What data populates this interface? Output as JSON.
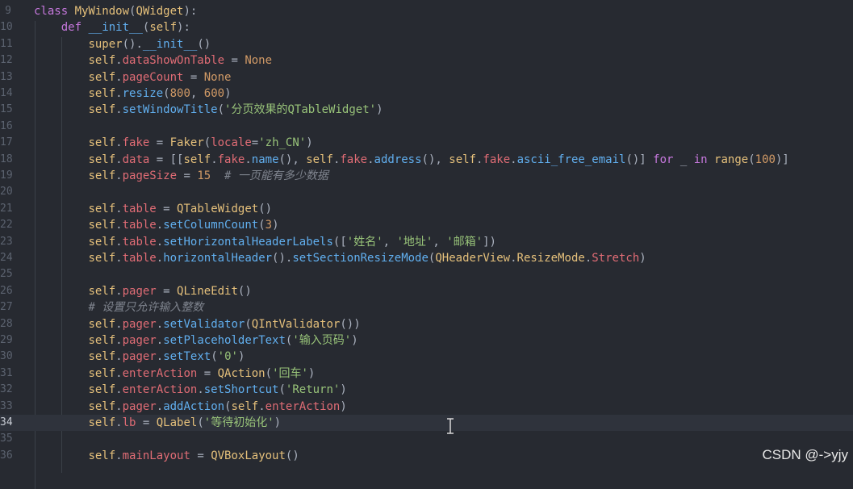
{
  "watermark": "CSDN @->yjy",
  "lines": [
    {
      "n": "9",
      "t": [
        [
          "kw",
          "class "
        ],
        [
          "cl",
          "MyWindow"
        ],
        [
          "pn",
          "("
        ],
        [
          "cl",
          "QWidget"
        ],
        [
          "pn",
          "):"
        ]
      ]
    },
    {
      "n": "10",
      "t": [
        [
          "pn",
          "    "
        ],
        [
          "kw",
          "def "
        ],
        [
          "fn",
          "__init__"
        ],
        [
          "pn",
          "("
        ],
        [
          "sf",
          "self"
        ],
        [
          "pn",
          "):"
        ]
      ]
    },
    {
      "n": "11",
      "t": [
        [
          "pn",
          "        "
        ],
        [
          "bi",
          "super"
        ],
        [
          "pn",
          "()."
        ],
        [
          "fn",
          "__init__"
        ],
        [
          "pn",
          "()"
        ]
      ]
    },
    {
      "n": "12",
      "t": [
        [
          "pn",
          "        "
        ],
        [
          "sf",
          "self"
        ],
        [
          "pn",
          "."
        ],
        [
          "at",
          "dataShowOnTable"
        ],
        [
          "pn",
          " = "
        ],
        [
          "nm",
          "None"
        ]
      ]
    },
    {
      "n": "13",
      "t": [
        [
          "pn",
          "        "
        ],
        [
          "sf",
          "self"
        ],
        [
          "pn",
          "."
        ],
        [
          "at",
          "pageCount"
        ],
        [
          "pn",
          " = "
        ],
        [
          "nm",
          "None"
        ]
      ]
    },
    {
      "n": "14",
      "t": [
        [
          "pn",
          "        "
        ],
        [
          "sf",
          "self"
        ],
        [
          "pn",
          "."
        ],
        [
          "fn",
          "resize"
        ],
        [
          "pn",
          "("
        ],
        [
          "nm",
          "800"
        ],
        [
          "pn",
          ", "
        ],
        [
          "nm",
          "600"
        ],
        [
          "pn",
          ")"
        ]
      ]
    },
    {
      "n": "15",
      "t": [
        [
          "pn",
          "        "
        ],
        [
          "sf",
          "self"
        ],
        [
          "pn",
          "."
        ],
        [
          "fn",
          "setWindowTitle"
        ],
        [
          "pn",
          "("
        ],
        [
          "st",
          "'分页效果的QTableWidget'"
        ],
        [
          "pn",
          ")"
        ]
      ]
    },
    {
      "n": "16",
      "t": []
    },
    {
      "n": "17",
      "t": [
        [
          "pn",
          "        "
        ],
        [
          "sf",
          "self"
        ],
        [
          "pn",
          "."
        ],
        [
          "at",
          "fake"
        ],
        [
          "pn",
          " = "
        ],
        [
          "cl",
          "Faker"
        ],
        [
          "pn",
          "("
        ],
        [
          "at",
          "locale"
        ],
        [
          "pn",
          "="
        ],
        [
          "st",
          "'zh_CN'"
        ],
        [
          "pn",
          ")"
        ]
      ]
    },
    {
      "n": "18",
      "t": [
        [
          "pn",
          "        "
        ],
        [
          "sf",
          "self"
        ],
        [
          "pn",
          "."
        ],
        [
          "at",
          "data"
        ],
        [
          "pn",
          " = [["
        ],
        [
          "sf",
          "self"
        ],
        [
          "pn",
          "."
        ],
        [
          "at",
          "fake"
        ],
        [
          "pn",
          "."
        ],
        [
          "fn",
          "name"
        ],
        [
          "pn",
          "(), "
        ],
        [
          "sf",
          "self"
        ],
        [
          "pn",
          "."
        ],
        [
          "at",
          "fake"
        ],
        [
          "pn",
          "."
        ],
        [
          "fn",
          "address"
        ],
        [
          "pn",
          "(), "
        ],
        [
          "sf",
          "self"
        ],
        [
          "pn",
          "."
        ],
        [
          "at",
          "fake"
        ],
        [
          "pn",
          "."
        ],
        [
          "fn",
          "ascii_free_email"
        ],
        [
          "pn",
          "()] "
        ],
        [
          "kw",
          "for"
        ],
        [
          "pn",
          " _ "
        ],
        [
          "kw",
          "in"
        ],
        [
          "pn",
          " "
        ],
        [
          "bi",
          "range"
        ],
        [
          "pn",
          "("
        ],
        [
          "nm",
          "100"
        ],
        [
          "pn",
          ")]"
        ]
      ]
    },
    {
      "n": "19",
      "t": [
        [
          "pn",
          "        "
        ],
        [
          "sf",
          "self"
        ],
        [
          "pn",
          "."
        ],
        [
          "at",
          "pageSize"
        ],
        [
          "pn",
          " = "
        ],
        [
          "nm",
          "15"
        ],
        [
          "pn",
          "  "
        ],
        [
          "co",
          "# 一页能有多少数据"
        ]
      ]
    },
    {
      "n": "20",
      "t": []
    },
    {
      "n": "21",
      "t": [
        [
          "pn",
          "        "
        ],
        [
          "sf",
          "self"
        ],
        [
          "pn",
          "."
        ],
        [
          "at",
          "table"
        ],
        [
          "pn",
          " = "
        ],
        [
          "cl",
          "QTableWidget"
        ],
        [
          "pn",
          "()"
        ]
      ]
    },
    {
      "n": "22",
      "t": [
        [
          "pn",
          "        "
        ],
        [
          "sf",
          "self"
        ],
        [
          "pn",
          "."
        ],
        [
          "at",
          "table"
        ],
        [
          "pn",
          "."
        ],
        [
          "fn",
          "setColumnCount"
        ],
        [
          "pn",
          "("
        ],
        [
          "nm",
          "3"
        ],
        [
          "pn",
          ")"
        ]
      ]
    },
    {
      "n": "23",
      "t": [
        [
          "pn",
          "        "
        ],
        [
          "sf",
          "self"
        ],
        [
          "pn",
          "."
        ],
        [
          "at",
          "table"
        ],
        [
          "pn",
          "."
        ],
        [
          "fn",
          "setHorizontalHeaderLabels"
        ],
        [
          "pn",
          "(["
        ],
        [
          "st",
          "'姓名'"
        ],
        [
          "pn",
          ", "
        ],
        [
          "st",
          "'地址'"
        ],
        [
          "pn",
          ", "
        ],
        [
          "st",
          "'邮箱'"
        ],
        [
          "pn",
          "])"
        ]
      ]
    },
    {
      "n": "24",
      "t": [
        [
          "pn",
          "        "
        ],
        [
          "sf",
          "self"
        ],
        [
          "pn",
          "."
        ],
        [
          "at",
          "table"
        ],
        [
          "pn",
          "."
        ],
        [
          "fn",
          "horizontalHeader"
        ],
        [
          "pn",
          "()."
        ],
        [
          "fn",
          "setSectionResizeMode"
        ],
        [
          "pn",
          "("
        ],
        [
          "cl",
          "QHeaderView"
        ],
        [
          "pn",
          "."
        ],
        [
          "cl",
          "ResizeMode"
        ],
        [
          "pn",
          "."
        ],
        [
          "at",
          "Stretch"
        ],
        [
          "pn",
          ")"
        ]
      ]
    },
    {
      "n": "25",
      "t": []
    },
    {
      "n": "26",
      "t": [
        [
          "pn",
          "        "
        ],
        [
          "sf",
          "self"
        ],
        [
          "pn",
          "."
        ],
        [
          "at",
          "pager"
        ],
        [
          "pn",
          " = "
        ],
        [
          "cl",
          "QLineEdit"
        ],
        [
          "pn",
          "()"
        ]
      ]
    },
    {
      "n": "27",
      "t": [
        [
          "pn",
          "        "
        ],
        [
          "co",
          "# 设置只允许输入整数"
        ]
      ]
    },
    {
      "n": "28",
      "t": [
        [
          "pn",
          "        "
        ],
        [
          "sf",
          "self"
        ],
        [
          "pn",
          "."
        ],
        [
          "at",
          "pager"
        ],
        [
          "pn",
          "."
        ],
        [
          "fn",
          "setValidator"
        ],
        [
          "pn",
          "("
        ],
        [
          "cl",
          "QIntValidator"
        ],
        [
          "pn",
          "())"
        ]
      ]
    },
    {
      "n": "29",
      "t": [
        [
          "pn",
          "        "
        ],
        [
          "sf",
          "self"
        ],
        [
          "pn",
          "."
        ],
        [
          "at",
          "pager"
        ],
        [
          "pn",
          "."
        ],
        [
          "fn",
          "setPlaceholderText"
        ],
        [
          "pn",
          "("
        ],
        [
          "st",
          "'输入页码'"
        ],
        [
          "pn",
          ")"
        ]
      ]
    },
    {
      "n": "30",
      "t": [
        [
          "pn",
          "        "
        ],
        [
          "sf",
          "self"
        ],
        [
          "pn",
          "."
        ],
        [
          "at",
          "pager"
        ],
        [
          "pn",
          "."
        ],
        [
          "fn",
          "setText"
        ],
        [
          "pn",
          "("
        ],
        [
          "st",
          "'0'"
        ],
        [
          "pn",
          ")"
        ]
      ]
    },
    {
      "n": "31",
      "t": [
        [
          "pn",
          "        "
        ],
        [
          "sf",
          "self"
        ],
        [
          "pn",
          "."
        ],
        [
          "at",
          "enterAction"
        ],
        [
          "pn",
          " = "
        ],
        [
          "cl",
          "QAction"
        ],
        [
          "pn",
          "("
        ],
        [
          "st",
          "'回车'"
        ],
        [
          "pn",
          ")"
        ]
      ]
    },
    {
      "n": "32",
      "t": [
        [
          "pn",
          "        "
        ],
        [
          "sf",
          "self"
        ],
        [
          "pn",
          "."
        ],
        [
          "at",
          "enterAction"
        ],
        [
          "pn",
          "."
        ],
        [
          "fn",
          "setShortcut"
        ],
        [
          "pn",
          "("
        ],
        [
          "st",
          "'Return'"
        ],
        [
          "pn",
          ")"
        ]
      ]
    },
    {
      "n": "33",
      "t": [
        [
          "pn",
          "        "
        ],
        [
          "sf",
          "self"
        ],
        [
          "pn",
          "."
        ],
        [
          "at",
          "pager"
        ],
        [
          "pn",
          "."
        ],
        [
          "fn",
          "addAction"
        ],
        [
          "pn",
          "("
        ],
        [
          "sf",
          "self"
        ],
        [
          "pn",
          "."
        ],
        [
          "at",
          "enterAction"
        ],
        [
          "pn",
          ")"
        ]
      ]
    },
    {
      "n": "34",
      "active": true,
      "t": [
        [
          "pn",
          "        "
        ],
        [
          "sf",
          "self"
        ],
        [
          "pn",
          "."
        ],
        [
          "at",
          "lb"
        ],
        [
          "pn",
          " = "
        ],
        [
          "cl",
          "QLabel"
        ],
        [
          "pn",
          "("
        ],
        [
          "st",
          "'等待初始化'"
        ],
        [
          "pn",
          ")"
        ]
      ]
    },
    {
      "n": "35",
      "t": []
    },
    {
      "n": "36",
      "t": [
        [
          "pn",
          "        "
        ],
        [
          "sf",
          "self"
        ],
        [
          "pn",
          "."
        ],
        [
          "at",
          "mainLayout"
        ],
        [
          "pn",
          " = "
        ],
        [
          "cl",
          "QVBoxLayout"
        ],
        [
          "pn",
          "()"
        ]
      ]
    }
  ]
}
